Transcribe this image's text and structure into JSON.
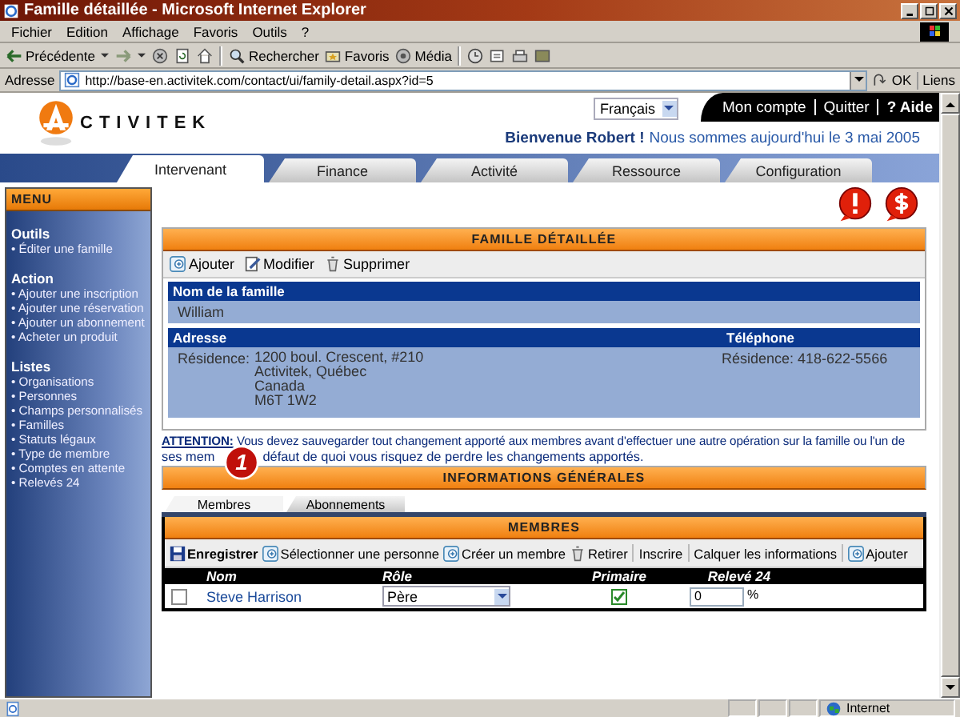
{
  "window": {
    "title": "Famille détaillée - Microsoft Internet Explorer"
  },
  "menu_bar": [
    "Fichier",
    "Edition",
    "Affichage",
    "Favoris",
    "Outils",
    "?"
  ],
  "toolbar": [
    {
      "kind": "back",
      "label": "Précédente"
    },
    {
      "kind": "forward"
    },
    {
      "kind": "stop"
    },
    {
      "kind": "refresh"
    },
    {
      "kind": "home"
    },
    {
      "kind": "search",
      "label": "Rechercher"
    },
    {
      "kind": "favorites",
      "label": "Favoris"
    },
    {
      "kind": "media",
      "label": "Média"
    },
    {
      "kind": "history"
    },
    {
      "kind": "mail"
    },
    {
      "kind": "print"
    },
    {
      "kind": "edit"
    }
  ],
  "address_bar": {
    "label": "Adresse",
    "url": "http://base-en.activitek.com/contact/ui/family-detail.aspx?id=5",
    "go": "OK",
    "links": "Liens"
  },
  "header": {
    "logo_text": "CTIVITEK",
    "language": "Français",
    "account_links": [
      "Mon compte",
      "Quitter"
    ],
    "help": "? Aide",
    "welcome_name": "Bienvenue Robert !",
    "welcome_text": "Nous sommes aujourd'hui le 3 mai 2005"
  },
  "tabs": [
    {
      "label": "Intervenant",
      "selected": true
    },
    {
      "label": "Finance",
      "selected": false
    },
    {
      "label": "Activité",
      "selected": false
    },
    {
      "label": "Ressource",
      "selected": false
    },
    {
      "label": "Configuration",
      "selected": false
    }
  ],
  "sidebar": {
    "title": "MENU",
    "groups": [
      {
        "title": "Outils",
        "items": [
          "• Éditer une famille"
        ]
      },
      {
        "title": "Action",
        "items": [
          "• Ajouter une inscription",
          "• Ajouter une réservation",
          "• Ajouter un abonnement",
          "• Acheter un produit"
        ]
      },
      {
        "title": "Listes",
        "items": [
          "• Organisations",
          "• Personnes",
          "• Champs personnalisés",
          "• Familles",
          "• Statuts légaux",
          "• Type de membre",
          "• Comptes en attente",
          "• Relevés 24"
        ]
      }
    ]
  },
  "family": {
    "title": "FAMILLE DÉTAILLÉE",
    "actions": [
      {
        "kind": "add",
        "label": "Ajouter"
      },
      {
        "kind": "edit",
        "label": "Modifier"
      },
      {
        "kind": "delete",
        "label": "Supprimer"
      }
    ],
    "name_label": "Nom de la famille",
    "name": "William",
    "address_label": "Adresse",
    "address_type": "Résidence:",
    "address_lines": [
      "1200 boul. Crescent, #210",
      "Activitek, Québec",
      "Canada",
      "M6T 1W2"
    ],
    "phone_label": "Téléphone",
    "phone": "Résidence: 418-622-5566"
  },
  "warning": {
    "lead": "**ATTENTION:** Vous devez sauvegarder tout changement apporté aux membres avant d'effectuer une autre opération sur la famille ou l'un de",
    "lead_end": "ses mem",
    "badge": "1",
    "rest": "défaut de quoi vous risquez de perdre les changements apportés."
  },
  "general": {
    "title": "INFORMATIONS GÉNÉRALES",
    "tabs": [
      {
        "label": "Membres",
        "selected": true
      },
      {
        "label": "Abonnements",
        "selected": false
      }
    ]
  },
  "members": {
    "title": "MEMBRES",
    "actions": [
      {
        "kind": "save",
        "label": "Enregistrer"
      },
      {
        "kind": "select",
        "label": "Sélectionner une personne"
      },
      {
        "kind": "create",
        "label": "Créer un membre"
      },
      {
        "kind": "delete",
        "label": "Retirer"
      },
      {
        "kind": "text",
        "label": "Inscrire"
      },
      {
        "kind": "text",
        "label": "Calquer les informations"
      },
      {
        "kind": "add",
        "label": "Ajouter"
      }
    ],
    "columns": [
      "Nom",
      "Rôle",
      "Primaire",
      "Relevé 24"
    ],
    "rows": [
      {
        "checked": false,
        "name": "Steve Harrison",
        "role": "Père",
        "primary": true,
        "releve": "0",
        "unit": "%"
      }
    ]
  },
  "status_bar": {
    "zone": "Internet"
  }
}
